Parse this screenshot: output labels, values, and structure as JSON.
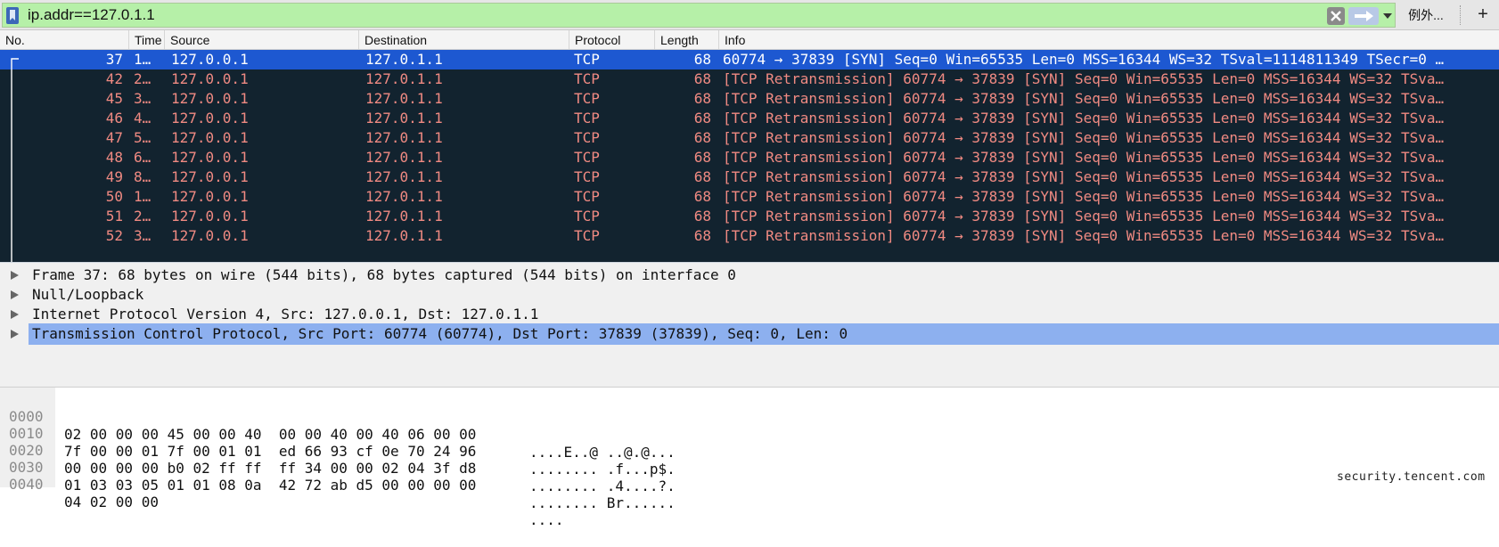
{
  "filter": {
    "value": "ip.addr==127.0.1.1",
    "expression_label": "例外...",
    "add_label": "+"
  },
  "columns": [
    "No.",
    "Time",
    "Source",
    "Destination",
    "Protocol",
    "Length",
    "Info"
  ],
  "packets": [
    {
      "no": "37",
      "time": "1…",
      "source": "127.0.0.1",
      "destination": "127.0.1.1",
      "protocol": "TCP",
      "length": "68",
      "info": "60774 → 37839 [SYN] Seq=0 Win=65535 Len=0 MSS=16344 WS=32 TSval=1114811349 TSecr=0 …",
      "selected": true
    },
    {
      "no": "42",
      "time": "2…",
      "source": "127.0.0.1",
      "destination": "127.0.1.1",
      "protocol": "TCP",
      "length": "68",
      "info": "[TCP Retransmission] 60774 → 37839 [SYN] Seq=0 Win=65535 Len=0 MSS=16344 WS=32 TSva…"
    },
    {
      "no": "45",
      "time": "3…",
      "source": "127.0.0.1",
      "destination": "127.0.1.1",
      "protocol": "TCP",
      "length": "68",
      "info": "[TCP Retransmission] 60774 → 37839 [SYN] Seq=0 Win=65535 Len=0 MSS=16344 WS=32 TSva…"
    },
    {
      "no": "46",
      "time": "4…",
      "source": "127.0.0.1",
      "destination": "127.0.1.1",
      "protocol": "TCP",
      "length": "68",
      "info": "[TCP Retransmission] 60774 → 37839 [SYN] Seq=0 Win=65535 Len=0 MSS=16344 WS=32 TSva…"
    },
    {
      "no": "47",
      "time": "5…",
      "source": "127.0.0.1",
      "destination": "127.0.1.1",
      "protocol": "TCP",
      "length": "68",
      "info": "[TCP Retransmission] 60774 → 37839 [SYN] Seq=0 Win=65535 Len=0 MSS=16344 WS=32 TSva…"
    },
    {
      "no": "48",
      "time": "6…",
      "source": "127.0.0.1",
      "destination": "127.0.1.1",
      "protocol": "TCP",
      "length": "68",
      "info": "[TCP Retransmission] 60774 → 37839 [SYN] Seq=0 Win=65535 Len=0 MSS=16344 WS=32 TSva…"
    },
    {
      "no": "49",
      "time": "8…",
      "source": "127.0.0.1",
      "destination": "127.0.1.1",
      "protocol": "TCP",
      "length": "68",
      "info": "[TCP Retransmission] 60774 → 37839 [SYN] Seq=0 Win=65535 Len=0 MSS=16344 WS=32 TSva…"
    },
    {
      "no": "50",
      "time": "1…",
      "source": "127.0.0.1",
      "destination": "127.0.1.1",
      "protocol": "TCP",
      "length": "68",
      "info": "[TCP Retransmission] 60774 → 37839 [SYN] Seq=0 Win=65535 Len=0 MSS=16344 WS=32 TSva…"
    },
    {
      "no": "51",
      "time": "2…",
      "source": "127.0.0.1",
      "destination": "127.0.1.1",
      "protocol": "TCP",
      "length": "68",
      "info": "[TCP Retransmission] 60774 → 37839 [SYN] Seq=0 Win=65535 Len=0 MSS=16344 WS=32 TSva…"
    },
    {
      "no": "52",
      "time": "3…",
      "source": "127.0.0.1",
      "destination": "127.0.1.1",
      "protocol": "TCP",
      "length": "68",
      "info": "[TCP Retransmission] 60774 → 37839 [SYN] Seq=0 Win=65535 Len=0 MSS=16344 WS=32 TSva…"
    }
  ],
  "details": [
    {
      "text": "Frame 37: 68 bytes on wire (544 bits), 68 bytes captured (544 bits) on interface 0"
    },
    {
      "text": "Null/Loopback"
    },
    {
      "text": "Internet Protocol Version 4, Src: 127.0.0.1, Dst: 127.0.1.1"
    },
    {
      "text": "Transmission Control Protocol, Src Port: 60774 (60774), Dst Port: 37839 (37839), Seq: 0, Len: 0",
      "selected": true
    }
  ],
  "bytes": [
    {
      "offset": "0000",
      "hex": "02 00 00 00 45 00 00 40  00 00 40 00 40 06 00 00",
      "ascii": "....E..@ ..@.@..."
    },
    {
      "offset": "0010",
      "hex": "7f 00 00 01 7f 00 01 01  ed 66 93 cf 0e 70 24 96",
      "ascii": "........ .f...p$."
    },
    {
      "offset": "0020",
      "hex": "00 00 00 00 b0 02 ff ff  ff 34 00 00 02 04 3f d8",
      "ascii": "........ .4....?."
    },
    {
      "offset": "0030",
      "hex": "01 03 03 05 01 01 08 0a  42 72 ab d5 00 00 00 00",
      "ascii": "........ Br......"
    },
    {
      "offset": "0040",
      "hex": "04 02 00 00",
      "ascii": "...."
    }
  ],
  "watermark": "security.tencent.com",
  "colors": {
    "filter_valid_bg": "#b6f0a8",
    "packet_list_bg": "#12232f",
    "packet_text": "#f08a82",
    "selected_row": "#1d58d1",
    "selected_detail": "#8db0ef"
  }
}
